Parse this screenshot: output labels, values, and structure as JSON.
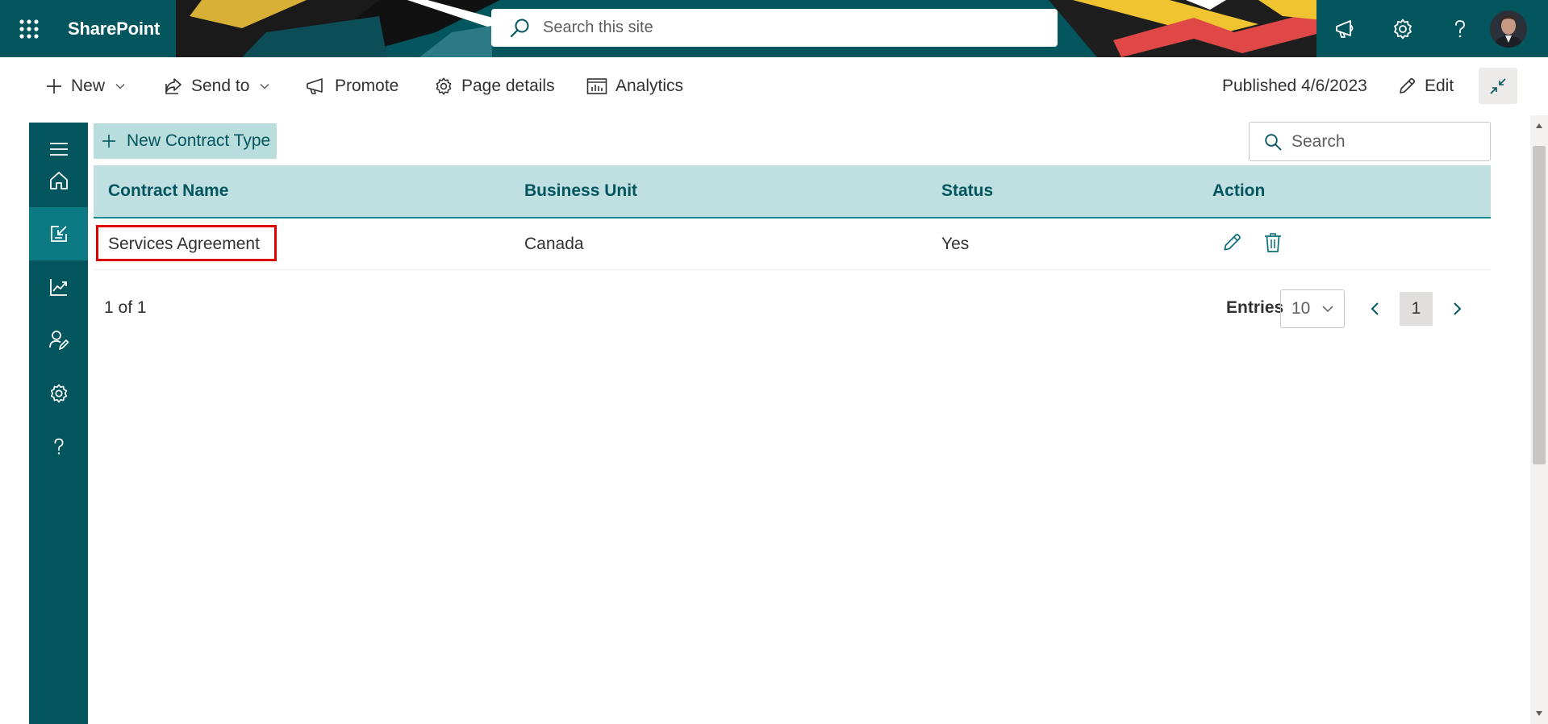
{
  "suite": {
    "app_name": "SharePoint",
    "search_placeholder": "Search this site",
    "icons": [
      "app-launcher-icon",
      "feedback-megaphone-icon",
      "settings-gear-icon",
      "help-question-icon",
      "user-avatar"
    ]
  },
  "command_bar": {
    "new_label": "New",
    "send_to_label": "Send to",
    "promote_label": "Promote",
    "page_details_label": "Page details",
    "analytics_label": "Analytics",
    "published_label": "Published 4/6/2023",
    "edit_label": "Edit"
  },
  "rail": {
    "items": [
      "hamburger-icon",
      "home-icon",
      "contracts-icon",
      "analytics-chart-icon",
      "user-edit-icon",
      "settings-gear-icon",
      "help-question-icon"
    ],
    "active": "contracts-icon"
  },
  "toolbar": {
    "new_contract_type_label": "New Contract Type",
    "search_placeholder": "Search"
  },
  "table": {
    "columns": [
      "Contract Name",
      "Business Unit",
      "Status",
      "Action"
    ],
    "rows": [
      {
        "contract_name": "Services Agreement",
        "business_unit": "Canada",
        "status": "Yes"
      }
    ]
  },
  "pager": {
    "count_text": "1 of 1",
    "entries_label": "Entries",
    "entries_value": "10",
    "current_page": "1"
  },
  "colors": {
    "theme_dark": "#03555e",
    "header_fill": "#bfdfe0",
    "highlight": "#e00000"
  }
}
